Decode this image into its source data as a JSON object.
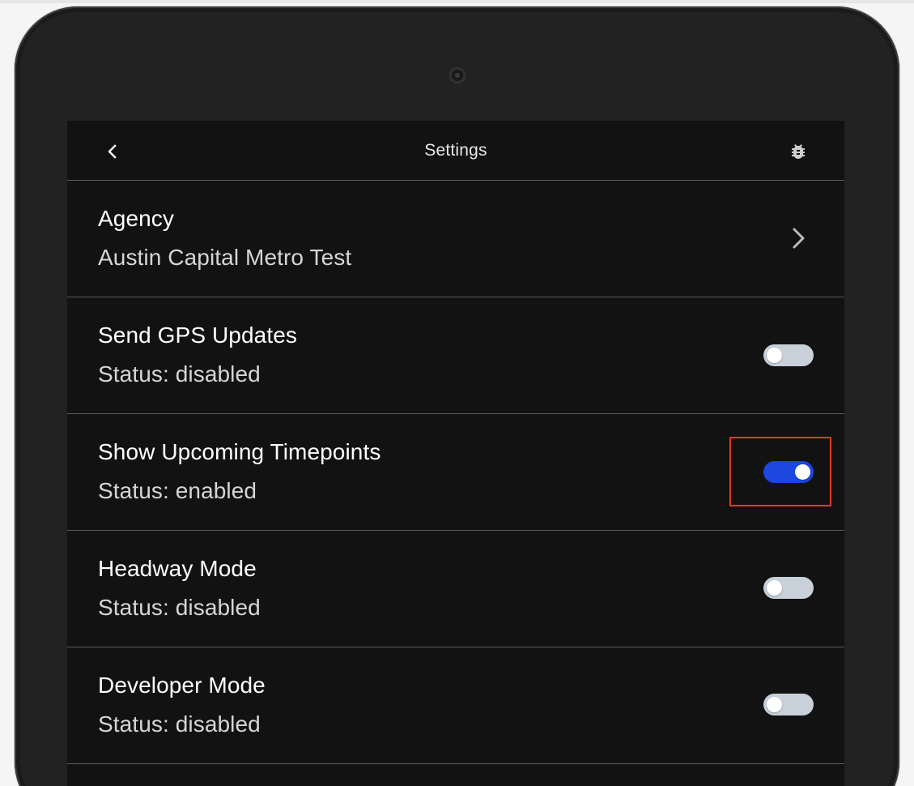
{
  "app_bar": {
    "title": "Settings",
    "back_icon": "chevron-left-icon",
    "debug_icon": "bug-icon"
  },
  "settings": {
    "agency": {
      "title": "Agency",
      "value": "Austin Capital Metro Test",
      "icon": "chevron-right-icon"
    },
    "send_gps": {
      "title": "Send GPS Updates",
      "status": "Status: disabled",
      "enabled": false
    },
    "upcoming_timepoints": {
      "title": "Show Upcoming Timepoints",
      "status": "Status: enabled",
      "enabled": true,
      "highlighted": true
    },
    "headway_mode": {
      "title": "Headway Mode",
      "status": "Status: disabled",
      "enabled": false
    },
    "developer_mode": {
      "title": "Developer Mode",
      "status": "Status: disabled",
      "enabled": false
    }
  },
  "colors": {
    "toggle_on": "#1c47e0",
    "toggle_off": "#c8d0da",
    "highlight": "#e2392b",
    "background": "#121212"
  }
}
